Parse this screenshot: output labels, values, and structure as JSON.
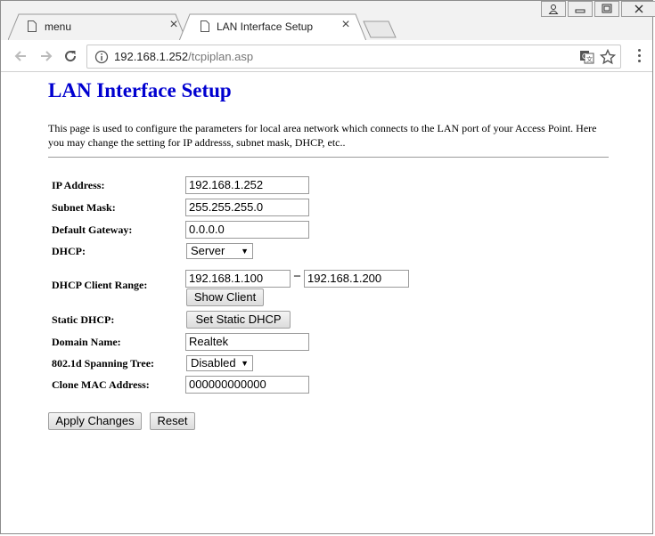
{
  "browser": {
    "tabs": [
      {
        "title": "menu"
      },
      {
        "title": "LAN Interface Setup"
      }
    ],
    "url_host": "192.168.1.252",
    "url_path": "/tcpiplan.asp"
  },
  "page": {
    "title": "LAN Interface Setup",
    "description": "This page is used to configure the parameters for local area network which connects to the LAN port of your Access Point. Here you may change the setting for IP addresss, subnet mask, DHCP, etc..",
    "fields": {
      "ip_label": "IP Address:",
      "ip_value": "192.168.1.252",
      "mask_label": "Subnet Mask:",
      "mask_value": "255.255.255.0",
      "gateway_label": "Default Gateway:",
      "gateway_value": "0.0.0.0",
      "dhcp_label": "DHCP:",
      "dhcp_value": "Server",
      "range_label": "DHCP Client Range:",
      "range_start": "192.168.1.100",
      "range_sep": "–",
      "range_end": "192.168.1.200",
      "show_client": "Show Client",
      "static_label": "Static DHCP:",
      "static_button": "Set Static DHCP",
      "domain_label": "Domain Name:",
      "domain_value": "Realtek",
      "stp_label": "802.1d Spanning Tree:",
      "stp_value": "Disabled",
      "mac_label": "Clone MAC Address:",
      "mac_value": "000000000000"
    },
    "buttons": {
      "apply": "Apply Changes",
      "reset": "Reset"
    }
  }
}
